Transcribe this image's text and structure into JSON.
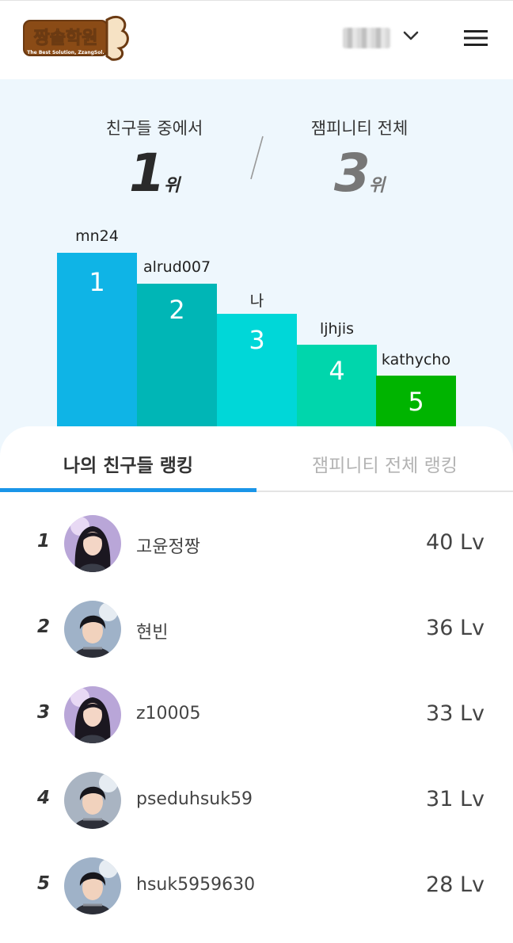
{
  "header": {
    "logo_text": "짱솔학원",
    "logo_tagline": "The Best Solution, ZzangSol.",
    "user_display": "",
    "menu_icon": "hamburger-icon",
    "dropdown_icon": "chevron-down-icon"
  },
  "summary": {
    "friends_label": "친구들 중에서",
    "friends_rank": "1",
    "friends_rank_unit": "위",
    "all_label": "잼피니티 전체",
    "all_rank": "3",
    "all_rank_unit": "위"
  },
  "podium": [
    {
      "name": "mn24",
      "rank": "1",
      "color": "#0fb4e6"
    },
    {
      "name": "alrud007",
      "rank": "2",
      "color": "#00b6b6"
    },
    {
      "name": "나",
      "rank": "3",
      "color": "#00d7d8"
    },
    {
      "name": "ljhjis",
      "rank": "4",
      "color": "#00d6ac"
    },
    {
      "name": "kathycho",
      "rank": "5",
      "color": "#00b400"
    }
  ],
  "tabs": {
    "friends": "나의 친구들 랭킹",
    "all": "잼피니티 전체 랭킹",
    "active_color": "#1a95e8"
  },
  "ranking": [
    {
      "rank": "1",
      "name": "고윤정짱",
      "level": "40 Lv",
      "avatar": "girl-avatar"
    },
    {
      "rank": "2",
      "name": "현빈",
      "level": "36 Lv",
      "avatar": "boy-avatar"
    },
    {
      "rank": "3",
      "name": "z10005",
      "level": "33 Lv",
      "avatar": "girl-avatar"
    },
    {
      "rank": "4",
      "name": "pseduhsuk59",
      "level": "31 Lv",
      "avatar": "boy-avatar"
    },
    {
      "rank": "5",
      "name": "hsuk5959630",
      "level": "28 Lv",
      "avatar": "boy-avatar"
    }
  ]
}
